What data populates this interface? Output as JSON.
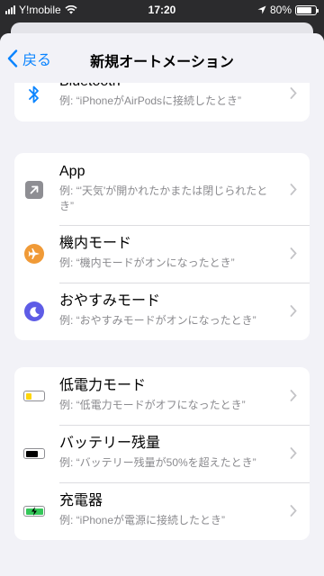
{
  "statusbar": {
    "carrier": "Y!mobile",
    "time": "17:20",
    "battery_percent": "80%"
  },
  "nav": {
    "back_label": "戻る",
    "title": "新規オートメーション"
  },
  "groups": [
    {
      "rows": [
        {
          "title": "Bluetooth",
          "subtitle": "例: “iPhoneがAirPodsに接続したとき”",
          "icon": "bluetooth-icon"
        }
      ]
    },
    {
      "rows": [
        {
          "title": "App",
          "subtitle": "例: “'天気'が開かれたかまたは閉じられたとき”",
          "icon": "app-arrow-icon"
        },
        {
          "title": "機内モード",
          "subtitle": "例: “機内モードがオンになったとき”",
          "icon": "airplane-icon"
        },
        {
          "title": "おやすみモード",
          "subtitle": "例: “おやすみモードがオンになったとき”",
          "icon": "moon-icon"
        }
      ]
    },
    {
      "rows": [
        {
          "title": "低電力モード",
          "subtitle": "例: “低電力モードがオフになったとき”",
          "icon": "low-power-battery-icon"
        },
        {
          "title": "バッテリー残量",
          "subtitle": "例: “バッテリー残量が50%を超えたとき”",
          "icon": "battery-level-icon"
        },
        {
          "title": "充電器",
          "subtitle": "例: “iPhoneが電源に接続したとき”",
          "icon": "charger-battery-icon"
        }
      ]
    }
  ],
  "colors": {
    "accent": "#0a84ff",
    "airplane": "#f09a37",
    "moon": "#5e5ce6",
    "low_power": "#ffd60a",
    "charging": "#34c759"
  }
}
